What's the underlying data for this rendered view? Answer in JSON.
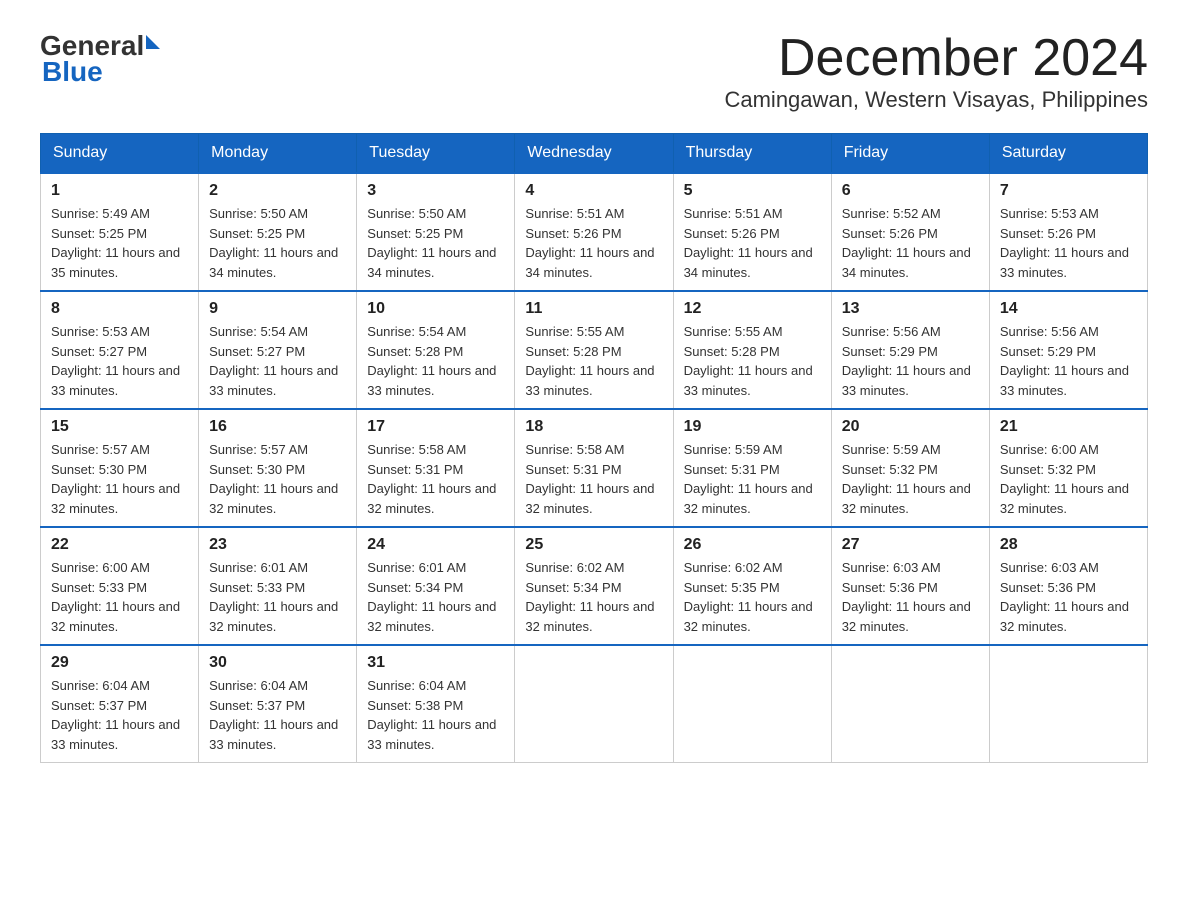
{
  "header": {
    "logo_general": "General",
    "logo_blue": "Blue",
    "month_title": "December 2024",
    "location": "Camingawan, Western Visayas, Philippines"
  },
  "weekdays": [
    "Sunday",
    "Monday",
    "Tuesday",
    "Wednesday",
    "Thursday",
    "Friday",
    "Saturday"
  ],
  "weeks": [
    [
      {
        "day": "1",
        "sunrise": "5:49 AM",
        "sunset": "5:25 PM",
        "daylight": "11 hours and 35 minutes."
      },
      {
        "day": "2",
        "sunrise": "5:50 AM",
        "sunset": "5:25 PM",
        "daylight": "11 hours and 34 minutes."
      },
      {
        "day": "3",
        "sunrise": "5:50 AM",
        "sunset": "5:25 PM",
        "daylight": "11 hours and 34 minutes."
      },
      {
        "day": "4",
        "sunrise": "5:51 AM",
        "sunset": "5:26 PM",
        "daylight": "11 hours and 34 minutes."
      },
      {
        "day": "5",
        "sunrise": "5:51 AM",
        "sunset": "5:26 PM",
        "daylight": "11 hours and 34 minutes."
      },
      {
        "day": "6",
        "sunrise": "5:52 AM",
        "sunset": "5:26 PM",
        "daylight": "11 hours and 34 minutes."
      },
      {
        "day": "7",
        "sunrise": "5:53 AM",
        "sunset": "5:26 PM",
        "daylight": "11 hours and 33 minutes."
      }
    ],
    [
      {
        "day": "8",
        "sunrise": "5:53 AM",
        "sunset": "5:27 PM",
        "daylight": "11 hours and 33 minutes."
      },
      {
        "day": "9",
        "sunrise": "5:54 AM",
        "sunset": "5:27 PM",
        "daylight": "11 hours and 33 minutes."
      },
      {
        "day": "10",
        "sunrise": "5:54 AM",
        "sunset": "5:28 PM",
        "daylight": "11 hours and 33 minutes."
      },
      {
        "day": "11",
        "sunrise": "5:55 AM",
        "sunset": "5:28 PM",
        "daylight": "11 hours and 33 minutes."
      },
      {
        "day": "12",
        "sunrise": "5:55 AM",
        "sunset": "5:28 PM",
        "daylight": "11 hours and 33 minutes."
      },
      {
        "day": "13",
        "sunrise": "5:56 AM",
        "sunset": "5:29 PM",
        "daylight": "11 hours and 33 minutes."
      },
      {
        "day": "14",
        "sunrise": "5:56 AM",
        "sunset": "5:29 PM",
        "daylight": "11 hours and 33 minutes."
      }
    ],
    [
      {
        "day": "15",
        "sunrise": "5:57 AM",
        "sunset": "5:30 PM",
        "daylight": "11 hours and 32 minutes."
      },
      {
        "day": "16",
        "sunrise": "5:57 AM",
        "sunset": "5:30 PM",
        "daylight": "11 hours and 32 minutes."
      },
      {
        "day": "17",
        "sunrise": "5:58 AM",
        "sunset": "5:31 PM",
        "daylight": "11 hours and 32 minutes."
      },
      {
        "day": "18",
        "sunrise": "5:58 AM",
        "sunset": "5:31 PM",
        "daylight": "11 hours and 32 minutes."
      },
      {
        "day": "19",
        "sunrise": "5:59 AM",
        "sunset": "5:31 PM",
        "daylight": "11 hours and 32 minutes."
      },
      {
        "day": "20",
        "sunrise": "5:59 AM",
        "sunset": "5:32 PM",
        "daylight": "11 hours and 32 minutes."
      },
      {
        "day": "21",
        "sunrise": "6:00 AM",
        "sunset": "5:32 PM",
        "daylight": "11 hours and 32 minutes."
      }
    ],
    [
      {
        "day": "22",
        "sunrise": "6:00 AM",
        "sunset": "5:33 PM",
        "daylight": "11 hours and 32 minutes."
      },
      {
        "day": "23",
        "sunrise": "6:01 AM",
        "sunset": "5:33 PM",
        "daylight": "11 hours and 32 minutes."
      },
      {
        "day": "24",
        "sunrise": "6:01 AM",
        "sunset": "5:34 PM",
        "daylight": "11 hours and 32 minutes."
      },
      {
        "day": "25",
        "sunrise": "6:02 AM",
        "sunset": "5:34 PM",
        "daylight": "11 hours and 32 minutes."
      },
      {
        "day": "26",
        "sunrise": "6:02 AM",
        "sunset": "5:35 PM",
        "daylight": "11 hours and 32 minutes."
      },
      {
        "day": "27",
        "sunrise": "6:03 AM",
        "sunset": "5:36 PM",
        "daylight": "11 hours and 32 minutes."
      },
      {
        "day": "28",
        "sunrise": "6:03 AM",
        "sunset": "5:36 PM",
        "daylight": "11 hours and 32 minutes."
      }
    ],
    [
      {
        "day": "29",
        "sunrise": "6:04 AM",
        "sunset": "5:37 PM",
        "daylight": "11 hours and 33 minutes."
      },
      {
        "day": "30",
        "sunrise": "6:04 AM",
        "sunset": "5:37 PM",
        "daylight": "11 hours and 33 minutes."
      },
      {
        "day": "31",
        "sunrise": "6:04 AM",
        "sunset": "5:38 PM",
        "daylight": "11 hours and 33 minutes."
      },
      null,
      null,
      null,
      null
    ]
  ]
}
